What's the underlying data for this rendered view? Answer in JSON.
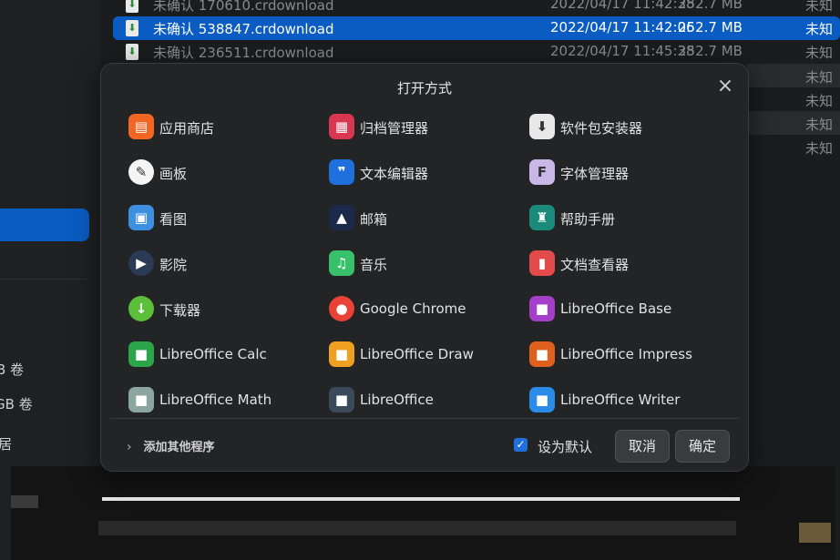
{
  "background": {
    "sidebar_items": [
      "B 卷",
      "GB 卷",
      "居"
    ],
    "files": [
      {
        "name": "未确认 170610.crdownload",
        "date": "2022/04/17 11:42:38",
        "size": "252.7 MB",
        "type": "未知"
      },
      {
        "name": "未确认 538847.crdownload",
        "date": "2022/04/17 11:42:06",
        "size": "252.7 MB",
        "type": "未知"
      },
      {
        "name": "未确认 236511.crdownload",
        "date": "2022/04/17 11:45:38",
        "size": "252.7 MB",
        "type": "未知"
      }
    ],
    "extra_types": [
      "未知",
      "未知",
      "未知",
      "未知"
    ]
  },
  "dialog": {
    "title": "打开方式",
    "close_glyph": "×",
    "apps": [
      {
        "label": "应用商店",
        "icon": "app-store-icon",
        "color": "#f26522"
      },
      {
        "label": "归档管理器",
        "icon": "archive-manager-icon",
        "color": "#d9364f"
      },
      {
        "label": "软件包安装器",
        "icon": "package-installer-icon",
        "color": "#e8e8e8"
      },
      {
        "label": "画板",
        "icon": "draw-icon",
        "color": "#f5f5f5"
      },
      {
        "label": "文本编辑器",
        "icon": "text-editor-icon",
        "color": "#1f6fdc"
      },
      {
        "label": "字体管理器",
        "icon": "font-manager-icon",
        "color": "#c9b7e8"
      },
      {
        "label": "看图",
        "icon": "image-viewer-icon",
        "color": "#3d8fe0"
      },
      {
        "label": "邮箱",
        "icon": "mail-icon",
        "color": "#1b2a4a"
      },
      {
        "label": "帮助手册",
        "icon": "manual-icon",
        "color": "#1a8a7a"
      },
      {
        "label": "影院",
        "icon": "movie-icon",
        "color": "#2b3a55"
      },
      {
        "label": "音乐",
        "icon": "music-icon",
        "color": "#38c06a"
      },
      {
        "label": "文档查看器",
        "icon": "document-viewer-icon",
        "color": "#e34a4a"
      },
      {
        "label": "下载器",
        "icon": "downloader-icon",
        "color": "#5cbf3a"
      },
      {
        "label": "Google Chrome",
        "icon": "chrome-icon",
        "color": "#ea4335"
      },
      {
        "label": "LibreOffice Base",
        "icon": "libreoffice-base-icon",
        "color": "#a33fc8"
      },
      {
        "label": "LibreOffice Calc",
        "icon": "libreoffice-calc-icon",
        "color": "#2aa54a"
      },
      {
        "label": "LibreOffice Draw",
        "icon": "libreoffice-draw-icon",
        "color": "#f0a020"
      },
      {
        "label": "LibreOffice Impress",
        "icon": "libreoffice-impress-icon",
        "color": "#e0601e"
      },
      {
        "label": "LibreOffice Math",
        "icon": "libreoffice-math-icon",
        "color": "#8aa69e"
      },
      {
        "label": "LibreOffice",
        "icon": "libreoffice-icon",
        "color": "#3b4a5a"
      },
      {
        "label": "LibreOffice Writer",
        "icon": "libreoffice-writer-icon",
        "color": "#2a8ce8"
      }
    ],
    "add_other": "添加其他程序",
    "set_default": "设为默认",
    "cancel": "取消",
    "ok": "确定"
  },
  "colors": {
    "accent": "#0a5cc2",
    "dialog_bg": "#232426",
    "checkbox": "#1f6fdc"
  }
}
